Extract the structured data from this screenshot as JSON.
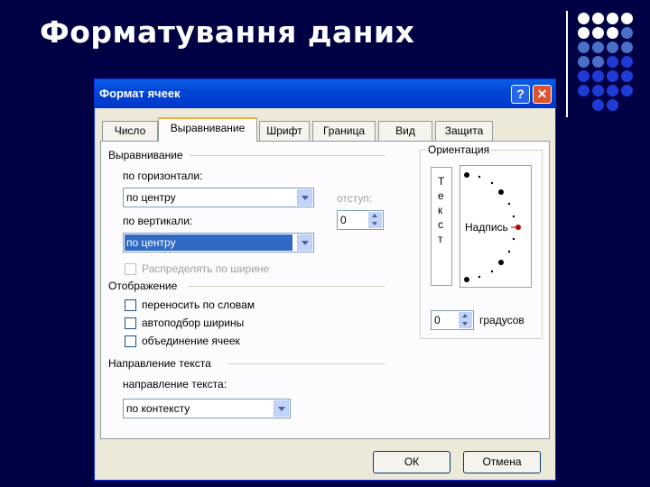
{
  "slide": {
    "title": "Форматування даних",
    "dot_colors": [
      "#ffffff",
      "#4a6fc9",
      "#1f3bd6"
    ]
  },
  "dialog": {
    "title": "Формат ячеек",
    "help_icon": "?",
    "close_icon": "✕",
    "tabs": [
      {
        "label": "Число",
        "active": false
      },
      {
        "label": "Выравнивание",
        "active": true
      },
      {
        "label": "Шрифт",
        "active": false
      },
      {
        "label": "Граница",
        "active": false
      },
      {
        "label": "Вид",
        "active": false
      },
      {
        "label": "Защита",
        "active": false
      }
    ],
    "alignment": {
      "group_label": "Выравнивание",
      "horizontal_label": "по горизонтали:",
      "horizontal_value": "по центру",
      "indent_label": "отступ:",
      "indent_value": "0",
      "vertical_label": "по вертикали:",
      "vertical_value": "по центру",
      "distribute_label": "Распределять по ширине"
    },
    "display": {
      "group_label": "Отображение",
      "wrap_label": "переносить по словам",
      "autofit_label": "автоподбор ширины",
      "merge_label": "объединение ячеек"
    },
    "direction": {
      "group_label": "Направление текста",
      "direction_label": "направление текста:",
      "direction_value": "по контексту"
    },
    "orientation": {
      "group_label": "Ориентация",
      "vertical_letters": [
        "Т",
        "е",
        "к",
        "с",
        "т"
      ],
      "dial_label": "Надпись",
      "degrees_value": "0",
      "degrees_label": "градусов"
    },
    "buttons": {
      "ok": "ОК",
      "cancel": "Отмена"
    }
  }
}
